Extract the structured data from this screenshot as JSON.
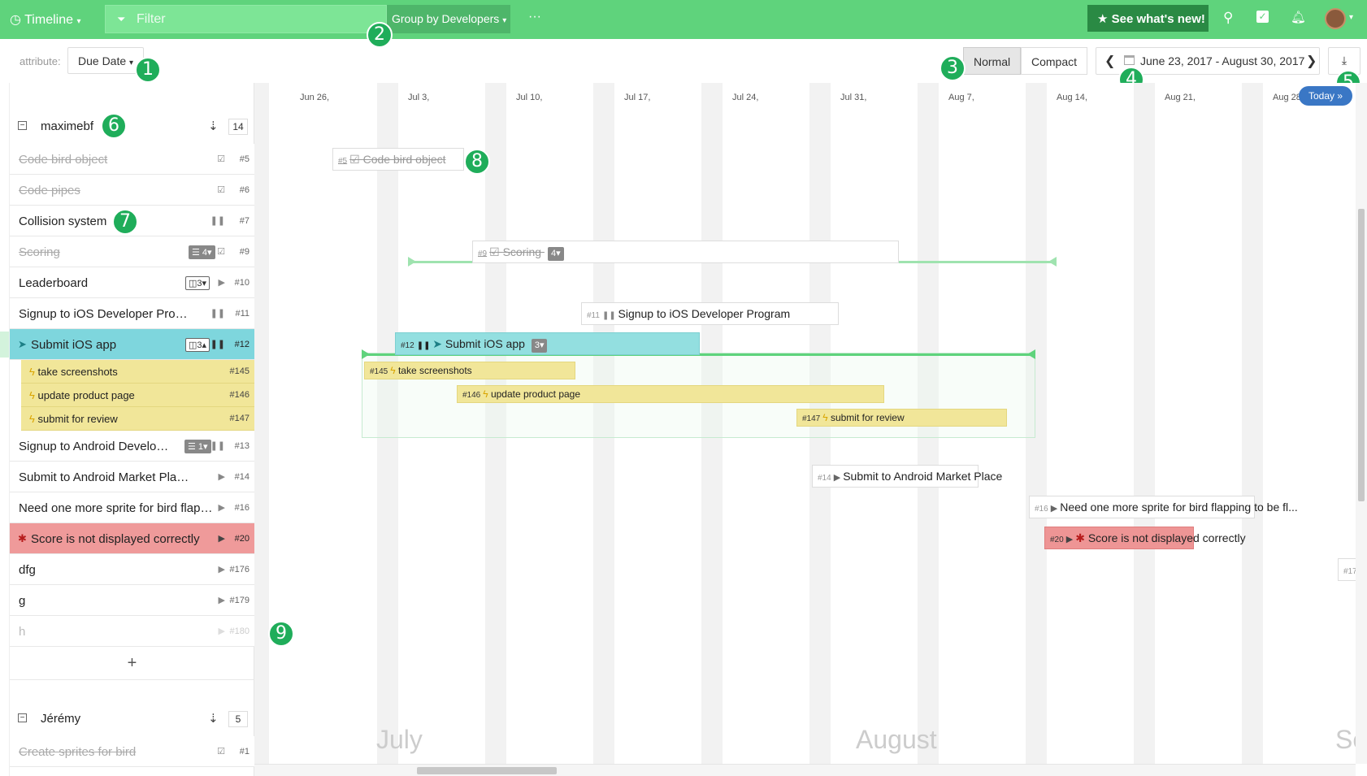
{
  "topbar": {
    "view": "Timeline",
    "filter_placeholder": "Filter",
    "group_by": "Group by Developers",
    "more": "···",
    "whats_new": "See what's new!"
  },
  "toolbar": {
    "attribute_label": "attribute:",
    "attribute_value": "Due Date",
    "normal": "Normal",
    "compact": "Compact",
    "date_range": "June 23, 2017 - August 30, 2017"
  },
  "markers": [
    "1",
    "2",
    "3",
    "4",
    "5",
    "6",
    "7",
    "8",
    "9"
  ],
  "groups": [
    {
      "name": "maximebf",
      "count": "14"
    },
    {
      "name": "Jérémy",
      "count": "5"
    }
  ],
  "rows": [
    {
      "title": "Code bird object",
      "num": "#5"
    },
    {
      "title": "Code pipes",
      "num": "#6"
    },
    {
      "title": "Collision system",
      "num": "#7"
    },
    {
      "title": "Scoring",
      "num": "#9",
      "badge": "4"
    },
    {
      "title": "Leaderboard",
      "num": "#10",
      "badge": "3"
    },
    {
      "title": "Signup to iOS Developer Program",
      "num": "#11"
    },
    {
      "title": "Submit iOS app",
      "num": "#12",
      "badge": "3"
    },
    {
      "title": "Signup to Android Developer Program",
      "num": "#13",
      "badge": "1"
    },
    {
      "title": "Submit to Android Market Place",
      "num": "#14"
    },
    {
      "title": "Need one more sprite for bird flapping to be fluid",
      "num": "#16"
    },
    {
      "title": "Score is not displayed correctly",
      "num": "#20"
    },
    {
      "title": "dfg",
      "num": "#176"
    },
    {
      "title": "g",
      "num": "#179"
    },
    {
      "title": "h",
      "num": "#180"
    },
    {
      "title": "Create sprites for bird",
      "num": "#1"
    }
  ],
  "subtasks": [
    {
      "title": "take screenshots",
      "num": "#145"
    },
    {
      "title": "update product page",
      "num": "#146"
    },
    {
      "title": "submit for review",
      "num": "#147"
    }
  ],
  "timeline": {
    "weeks": [
      "Jun 26,",
      "Jul 3,",
      "Jul 10,",
      "Jul 17,",
      "Jul 24,",
      "Jul 31,",
      "Aug 7,",
      "Aug 14,",
      "Aug 21,",
      "Aug 28"
    ],
    "months": [
      "July",
      "August",
      "Se"
    ],
    "today": "Today",
    "bars": [
      {
        "id": "#5",
        "title": "Code bird object"
      },
      {
        "id": "#9",
        "title": "Scoring",
        "badge": "4"
      },
      {
        "id": "#11",
        "title": "Signup to iOS Developer Program"
      },
      {
        "id": "#12",
        "title": "Submit iOS app",
        "badge": "3"
      },
      {
        "id": "#145",
        "title": "take screenshots"
      },
      {
        "id": "#146",
        "title": "update product page"
      },
      {
        "id": "#147",
        "title": "submit for review"
      },
      {
        "id": "#14",
        "title": "Submit to Android Market Place"
      },
      {
        "id": "#16",
        "title": "Need one more sprite for bird flapping to be fl..."
      },
      {
        "id": "#20",
        "title": "Score is not displayed correctly"
      },
      {
        "id": "#17",
        "title": ""
      }
    ]
  },
  "colors": {
    "topbar": "#5fd37c",
    "selected": "#7ed6dd",
    "bug": "#ef9a9a",
    "subtask": "#f1e699",
    "marker": "#1fad5a"
  }
}
